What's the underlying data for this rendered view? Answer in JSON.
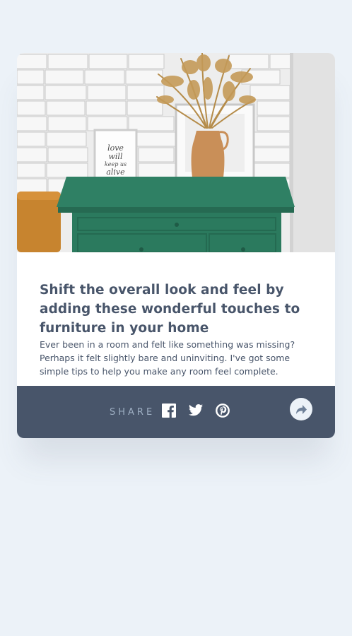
{
  "article": {
    "title": "Shift the overall look and feel by adding these wonderful touches to furniture in your home",
    "description": "Ever been in a room and felt like something was missing? Perhaps it felt slightly bare and uninviting. I've got some simple tips to help you make any room feel complete."
  },
  "photo": {
    "frame_text": "love will keep us alive"
  },
  "share": {
    "label": "SHARE",
    "icons": [
      "facebook-icon",
      "twitter-icon",
      "pinterest-icon",
      "share-arrow-icon"
    ]
  },
  "colors": {
    "page_background": "#ecf2f8",
    "heading_text": "#48556a",
    "share_bar": "#48556a",
    "share_label": "#9daec2",
    "icon": "#ffffff",
    "drawer_green": "#2e7d62"
  }
}
